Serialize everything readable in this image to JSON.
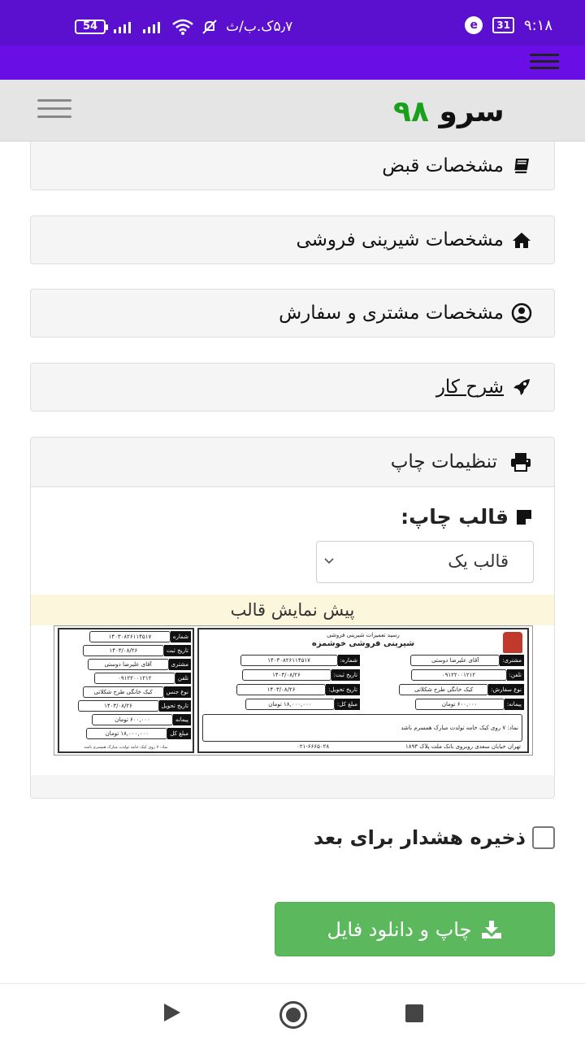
{
  "status_bar": {
    "battery": "54",
    "network_speed": "۵٫۷ک.ب/ث",
    "calendar_day": "31",
    "time": "۹:۱۸"
  },
  "site": {
    "logo_word": "سرو",
    "logo_number": "۹۸"
  },
  "panels": {
    "receipt_specs": "مشخصات قبض",
    "shop_specs": "مشخصات شیرینی فروشی",
    "customer_order": "مشخصات مشتری و سفارش",
    "work_description": "شرح کار",
    "print_settings": "تنظیمات چاپ"
  },
  "print": {
    "template_label": "قالب چاپ:",
    "template_selected": "قالب یک",
    "preview_title": "پیش نمایش قالب"
  },
  "receipt": {
    "header_small": "رسید تعمیرات شیرینی فروشی",
    "shop_name": "شیرینی فروشی خوشمزه",
    "labels": {
      "customer": "مشتری:",
      "number": "شماره:",
      "phone": "تلفن:",
      "reg_date": "تاریخ ثبت:",
      "order_type": "نوع سفارش:",
      "delivery_date": "تاریخ تحویل:",
      "size": "پیمانه:",
      "total": "مبلغ کل:",
      "left_number": "شماره",
      "left_reg_date": "تاریخ ثبت",
      "left_customer": "مشتری",
      "left_phone": "تلفن",
      "left_type": "نوع جنس",
      "left_delivery": "تاریخ تحویل",
      "left_size": "پیمانه",
      "left_total": "مبلغ کل"
    },
    "values": {
      "customer": "آقای علیرضا دوستی",
      "number": "۱۴۰۳۰۸۲۶۱۱۴۵۱۷",
      "phone": "۰۹۱۲۲۰۰۱۲۱۲",
      "reg_date": "۱۴۰۳/۰۸/۲۶",
      "order_type": "کیک خانگی طرح شکلاتی",
      "delivery_date": "۱۴۰۳/۰۸/۲۶",
      "size": "۶۰۰,۰۰۰ تومان",
      "total": "۱۸,۰۰۰,۰۰۰ تومان"
    },
    "note": "نماد: ۷ روی کیک خامه تولدت مبارک همسرم باشد",
    "address": "تهران خیابان سعدی روبروی بانک ملت پلاک ۱۸۹۳",
    "phone_footer": "۰۲۱-۶۶۶۵۰۲۸",
    "left_footer": "نماد: ۷ روی کیک خامه تولدت مبارک همسرم باشد"
  },
  "save_warning_label": "ذخیره هشدار برای بعد",
  "download_button": "چاپ و دانلود فایل"
}
